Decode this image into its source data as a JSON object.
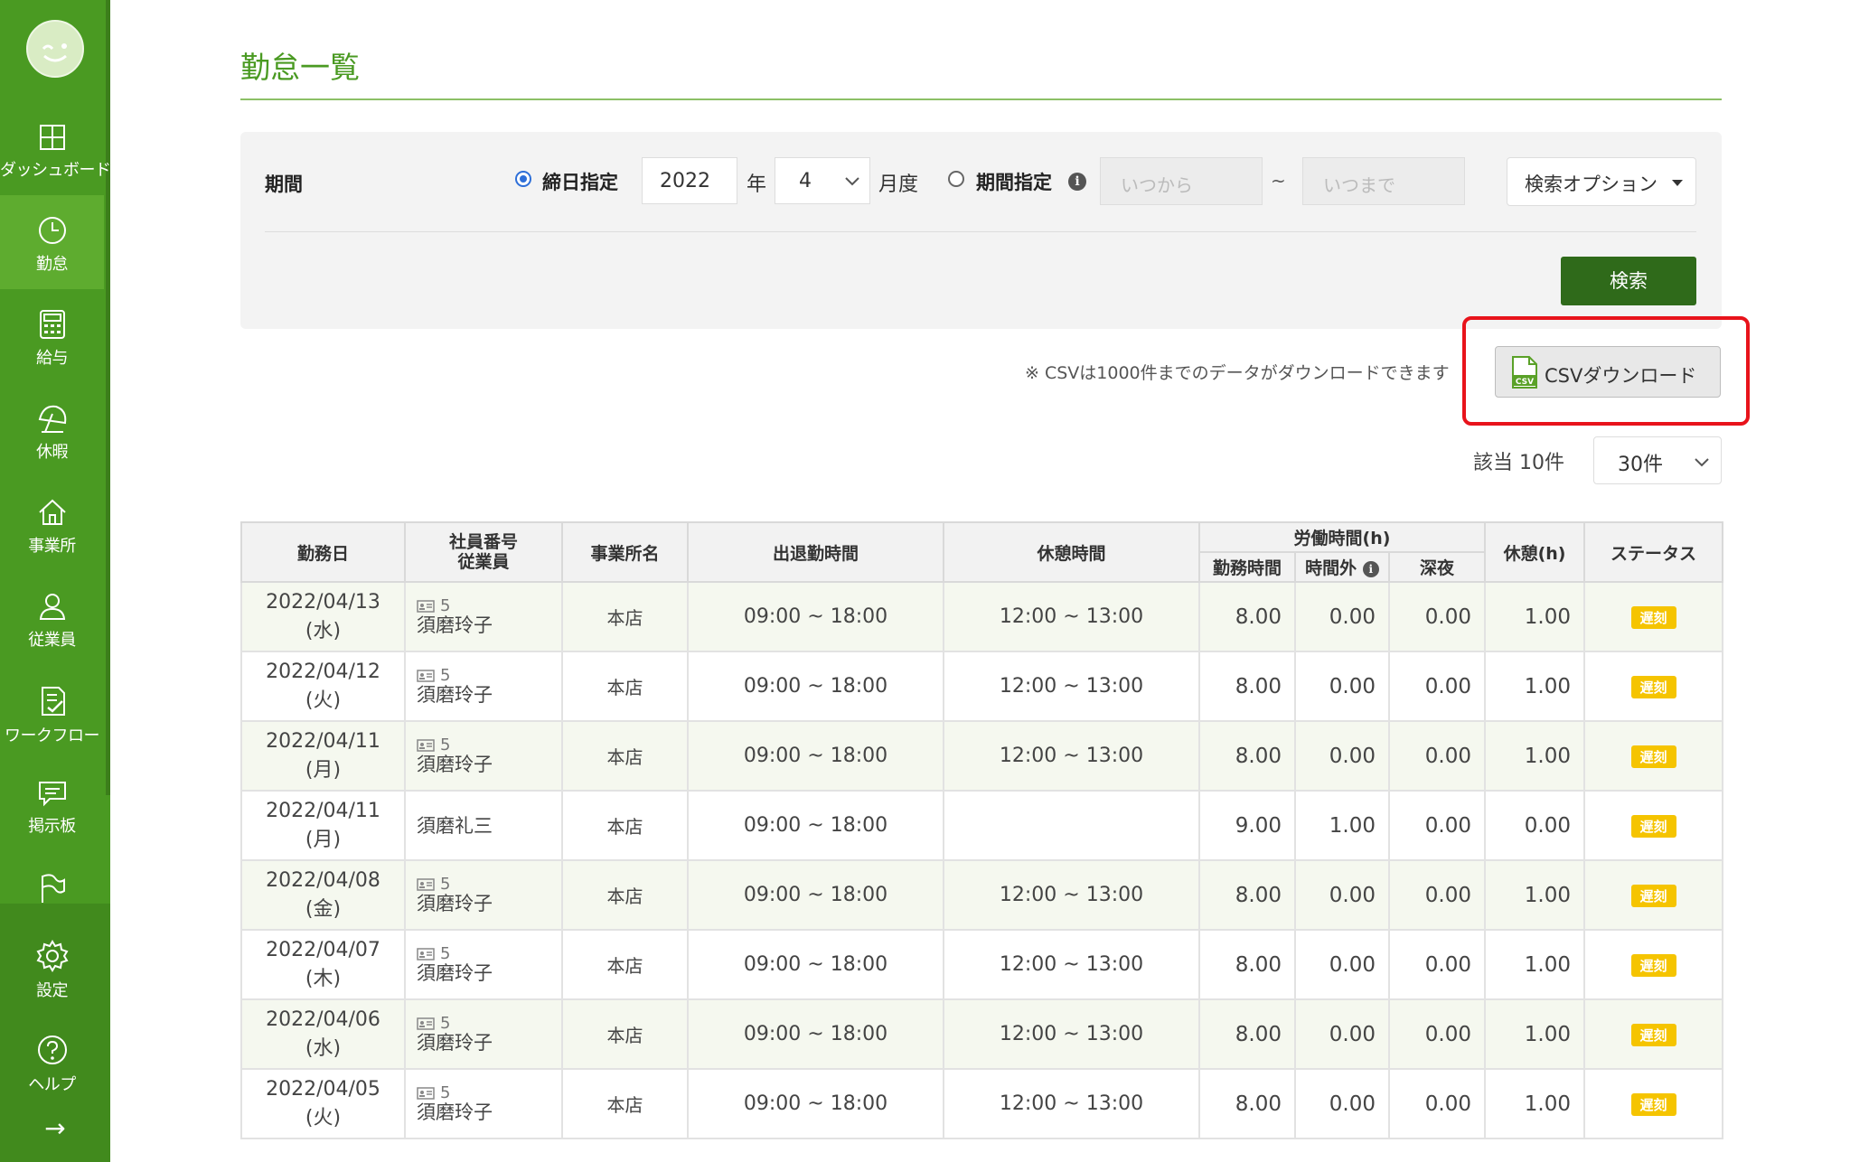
{
  "sidebar": {
    "items": [
      {
        "label": "ダッシュボード",
        "icon": "dashboard-icon"
      },
      {
        "label": "勤怠",
        "icon": "clock-icon"
      },
      {
        "label": "給与",
        "icon": "calculator-icon"
      },
      {
        "label": "休暇",
        "icon": "umbrella-icon"
      },
      {
        "label": "事業所",
        "icon": "home-icon"
      },
      {
        "label": "従業員",
        "icon": "user-icon"
      },
      {
        "label": "ワークフロー",
        "icon": "checklist-icon"
      },
      {
        "label": "掲示板",
        "icon": "chat-icon"
      }
    ],
    "settings_label": "設定",
    "help_label": "ヘルプ",
    "expand_icon": "→"
  },
  "page": {
    "title": "勤怠一覧"
  },
  "search": {
    "period_label": "期間",
    "closing_label": "締日指定",
    "year_value": "2022",
    "year_unit": "年",
    "month_value": "4",
    "month_unit": "月度",
    "range_label": "期間指定",
    "from_placeholder": "いつから",
    "to_placeholder": "いつまで",
    "tilde": "~",
    "options_label": "検索オプション",
    "search_button": "検索"
  },
  "csv": {
    "note": "※ CSVは1000件までのデータがダウンロードできます",
    "button": "CSVダウンロード"
  },
  "results": {
    "count_label": "該当 10件",
    "per_page": "30件"
  },
  "table": {
    "headers": {
      "date": "勤務日",
      "emp_no": "社員番号",
      "emp": "従業員",
      "office": "事業所名",
      "inout": "出退勤時間",
      "break": "休憩時間",
      "labor": "労働時間(h)",
      "work": "勤務時間",
      "overtime": "時間外",
      "night": "深夜",
      "rest": "休憩(h)",
      "status": "ステータス"
    },
    "rows": [
      {
        "date": "2022/04/13",
        "dow": "(水)",
        "emp_no": "5",
        "name": "須磨玲子",
        "office": "本店",
        "inout": "09:00 ~ 18:00",
        "break": "12:00 ~ 13:00",
        "work": "8.00",
        "overtime": "0.00",
        "night": "0.00",
        "rest": "1.00",
        "status": "遅刻"
      },
      {
        "date": "2022/04/12",
        "dow": "(火)",
        "emp_no": "5",
        "name": "須磨玲子",
        "office": "本店",
        "inout": "09:00 ~ 18:00",
        "break": "12:00 ~ 13:00",
        "work": "8.00",
        "overtime": "0.00",
        "night": "0.00",
        "rest": "1.00",
        "status": "遅刻"
      },
      {
        "date": "2022/04/11",
        "dow": "(月)",
        "emp_no": "5",
        "name": "須磨玲子",
        "office": "本店",
        "inout": "09:00 ~ 18:00",
        "break": "12:00 ~ 13:00",
        "work": "8.00",
        "overtime": "0.00",
        "night": "0.00",
        "rest": "1.00",
        "status": "遅刻"
      },
      {
        "date": "2022/04/11",
        "dow": "(月)",
        "emp_no": "",
        "name": "須磨礼三",
        "office": "本店",
        "inout": "09:00 ~ 18:00",
        "break": "",
        "work": "9.00",
        "overtime": "1.00",
        "night": "0.00",
        "rest": "0.00",
        "status": "遅刻"
      },
      {
        "date": "2022/04/08",
        "dow": "(金)",
        "emp_no": "5",
        "name": "須磨玲子",
        "office": "本店",
        "inout": "09:00 ~ 18:00",
        "break": "12:00 ~ 13:00",
        "work": "8.00",
        "overtime": "0.00",
        "night": "0.00",
        "rest": "1.00",
        "status": "遅刻"
      },
      {
        "date": "2022/04/07",
        "dow": "(木)",
        "emp_no": "5",
        "name": "須磨玲子",
        "office": "本店",
        "inout": "09:00 ~ 18:00",
        "break": "12:00 ~ 13:00",
        "work": "8.00",
        "overtime": "0.00",
        "night": "0.00",
        "rest": "1.00",
        "status": "遅刻"
      },
      {
        "date": "2022/04/06",
        "dow": "(水)",
        "emp_no": "5",
        "name": "須磨玲子",
        "office": "本店",
        "inout": "09:00 ~ 18:00",
        "break": "12:00 ~ 13:00",
        "work": "8.00",
        "overtime": "0.00",
        "night": "0.00",
        "rest": "1.00",
        "status": "遅刻"
      },
      {
        "date": "2022/04/05",
        "dow": "(火)",
        "emp_no": "5",
        "name": "須磨玲子",
        "office": "本店",
        "inout": "09:00 ~ 18:00",
        "break": "12:00 ~ 13:00",
        "work": "8.00",
        "overtime": "0.00",
        "night": "0.00",
        "rest": "1.00",
        "status": "遅刻"
      }
    ]
  },
  "colors": {
    "sidebar": "#4a9a22",
    "title": "#4a9a22",
    "search_button": "#2f6a1a",
    "highlight": "#e8131b",
    "badge": "#f5c400"
  }
}
